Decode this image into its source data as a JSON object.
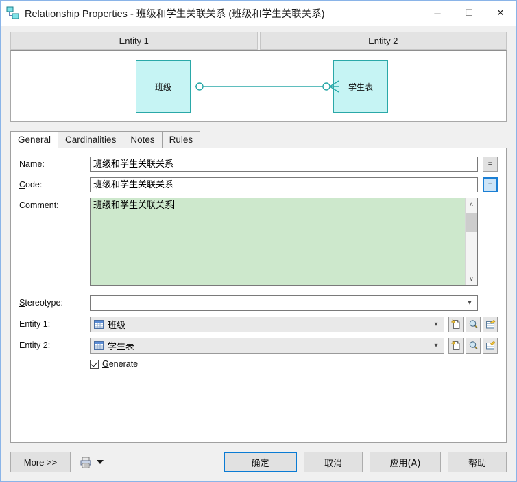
{
  "window": {
    "title": "Relationship Properties - 班级和学生关联关系 (班级和学生关联关系)",
    "icon": "relationship-icon",
    "controls": {
      "minimize": "─",
      "maximize": "☐",
      "close": "✕"
    }
  },
  "preview": {
    "headers": [
      "Entity 1",
      "Entity 2"
    ],
    "entity1_label": "班级",
    "entity2_label": "学生表",
    "entity_fill": "#c6f4f4",
    "entity_border": "#2aa8a8",
    "link_color": "#2aa8a8"
  },
  "tabs": [
    {
      "label": "General",
      "active": true
    },
    {
      "label": "Cardinalities",
      "active": false
    },
    {
      "label": "Notes",
      "active": false
    },
    {
      "label": "Rules",
      "active": false
    }
  ],
  "form": {
    "name": {
      "label_pre": "",
      "label_acc": "N",
      "label_post": "ame:",
      "value": "班级和学生关联关系",
      "equals_button": "="
    },
    "code": {
      "label_acc": "C",
      "label_post": "ode:",
      "value": "班级和学生关联关系",
      "equals_button": "="
    },
    "comment": {
      "label_pre": "C",
      "label_acc": "o",
      "label_post": "mment:",
      "value": "班级和学生关联关系",
      "background": "#cde8cc",
      "scroll_up": "∧",
      "scroll_down": "∨"
    },
    "stereotype": {
      "label_acc": "S",
      "label_post": "tereotype:",
      "value": "",
      "placeholder": ""
    },
    "entity1": {
      "label_pre": "Entity ",
      "label_acc": "1",
      "label_post": ":",
      "value": "班级",
      "icon": "table-grid-icon",
      "buttons": [
        "create-icon",
        "properties-icon",
        "select-icon"
      ]
    },
    "entity2": {
      "label_pre": "Entity ",
      "label_acc": "2",
      "label_post": ":",
      "value": "学生表",
      "icon": "table-grid-icon",
      "buttons": [
        "create-icon",
        "properties-icon",
        "select-icon"
      ]
    },
    "generate": {
      "label_pre": "",
      "label_acc": "G",
      "label_post": "enerate",
      "checked": true
    }
  },
  "footer": {
    "more_label": "More >>",
    "print_icon": "print-icon",
    "ok_label": "确定",
    "cancel_label": "取消",
    "apply_label": "应用(A)",
    "help_label": "帮助"
  }
}
